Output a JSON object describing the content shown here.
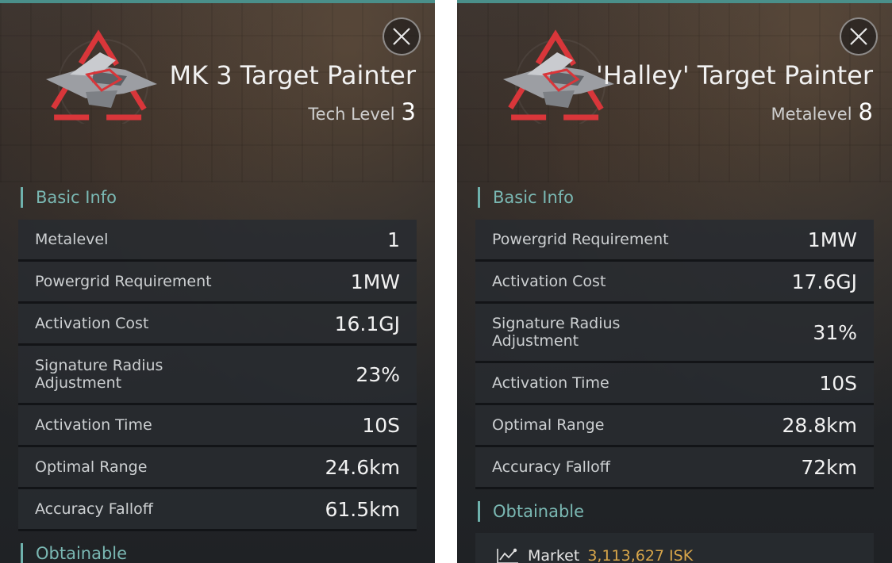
{
  "panels": [
    {
      "title": "MK 3 Target Painter",
      "subtitle_label": "Tech Level",
      "subtitle_value": "3",
      "basic_info_label": "Basic Info",
      "rows": [
        {
          "label": "Metalevel",
          "value": "1"
        },
        {
          "label": "Powergrid Requirement",
          "value": "1MW"
        },
        {
          "label": "Activation Cost",
          "value": "16.1GJ"
        },
        {
          "label": "Signature Radius Adjustment",
          "value": "23%"
        },
        {
          "label": "Activation Time",
          "value": "10S"
        },
        {
          "label": "Optimal Range",
          "value": "24.6km"
        },
        {
          "label": "Accuracy Falloff",
          "value": "61.5km"
        }
      ],
      "obtainable_label": "Obtainable"
    },
    {
      "title": "'Halley' Target Painter",
      "subtitle_label": "Metalevel",
      "subtitle_value": "8",
      "basic_info_label": "Basic Info",
      "rows": [
        {
          "label": "Powergrid Requirement",
          "value": "1MW"
        },
        {
          "label": "Activation Cost",
          "value": "17.6GJ"
        },
        {
          "label": "Signature Radius Adjustment",
          "value": "31%"
        },
        {
          "label": "Activation Time",
          "value": "10S"
        },
        {
          "label": "Optimal Range",
          "value": "28.8km"
        },
        {
          "label": "Accuracy Falloff",
          "value": "72km"
        }
      ],
      "obtainable_label": "Obtainable",
      "market_label": "Market",
      "market_value": "3,113,627 ISK"
    }
  ],
  "icons": {
    "close": "close-icon",
    "item": "target-painter-icon",
    "market": "market-chart-icon"
  },
  "colors": {
    "accent": "#6fb2ad",
    "isk": "#d8a64a",
    "icon_red": "#d9363a"
  }
}
